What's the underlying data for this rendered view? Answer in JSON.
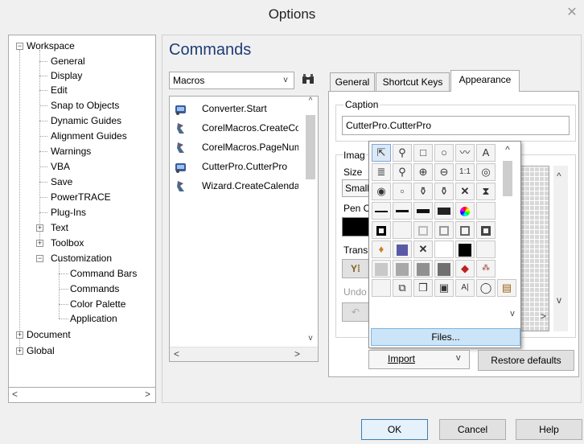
{
  "window": {
    "title": "Options",
    "close_label": "✕"
  },
  "tree": {
    "items": [
      {
        "label": "Workspace"
      },
      {
        "label": "General"
      },
      {
        "label": "Display"
      },
      {
        "label": "Edit"
      },
      {
        "label": "Snap to Objects"
      },
      {
        "label": "Dynamic Guides"
      },
      {
        "label": "Alignment Guides"
      },
      {
        "label": "Warnings"
      },
      {
        "label": "VBA"
      },
      {
        "label": "Save"
      },
      {
        "label": "PowerTRACE"
      },
      {
        "label": "Plug-Ins"
      },
      {
        "label": "Text"
      },
      {
        "label": "Toolbox"
      },
      {
        "label": "Customization"
      },
      {
        "label": "Command Bars"
      },
      {
        "label": "Commands"
      },
      {
        "label": "Color Palette"
      },
      {
        "label": "Application"
      },
      {
        "label": "Document"
      },
      {
        "label": "Global"
      }
    ],
    "scroll_left": "<",
    "scroll_right": ">"
  },
  "main": {
    "heading": "Commands",
    "category": {
      "value": "Macros",
      "arrow": "v"
    },
    "commands": [
      {
        "label": "Converter.Start"
      },
      {
        "label": "CorelMacros.CreateCo"
      },
      {
        "label": "CorelMacros.PageNum"
      },
      {
        "label": "CutterPro.CutterPro"
      },
      {
        "label": "Wizard.CreateCalenda"
      }
    ],
    "scroll_up": "^",
    "scroll_down": "v",
    "scroll_left": "<",
    "scroll_right": ">"
  },
  "tabs": [
    {
      "label": "General"
    },
    {
      "label": "Shortcut Keys"
    },
    {
      "label": "Appearance"
    }
  ],
  "appearance": {
    "caption_label": "Caption",
    "caption_value": "CutterPro.CutterPro",
    "image_label": "Imag",
    "size_label": "Size",
    "size_value": "Small",
    "pen_label": "Pen C",
    "trans_label": "Trans",
    "undo_label": "Undo",
    "files_label": "Files...",
    "import_label": "Import",
    "import_arrow": "v",
    "restore_label": "Restore defaults",
    "scroll_up": "^",
    "scroll_down": "v",
    "scroll_right": ">"
  },
  "footer": {
    "ok": "OK",
    "cancel": "Cancel",
    "help": "Help"
  },
  "colors": {
    "heading": "#1e3c78",
    "selection": "#cce4f7",
    "accent_blue": "#5a5aa8"
  }
}
